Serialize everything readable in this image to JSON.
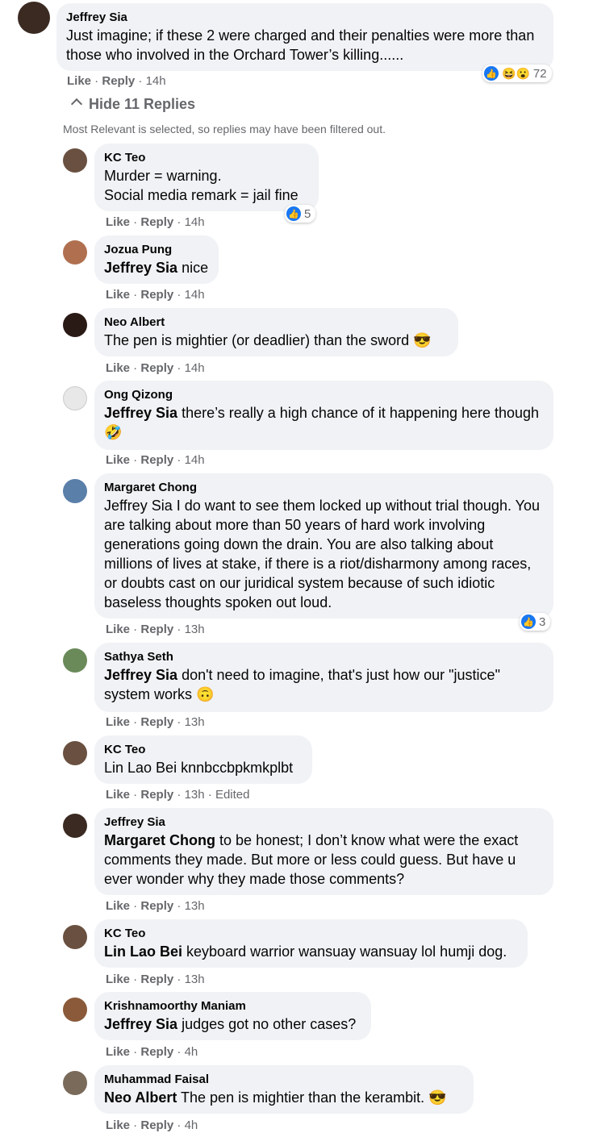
{
  "common": {
    "like": "Like",
    "reply": "Reply",
    "sep": " · "
  },
  "main_comment": {
    "author": "Jeffrey Sia",
    "text": "Just imagine; if these 2 were charged and their penalties were more than those who involved in the Orchard Tower’s killing......",
    "time": "14h",
    "reaction_count": "72",
    "reactions": [
      "like-icon",
      "haha-icon",
      "wow-icon"
    ]
  },
  "hide_replies_label": "Hide 11 Replies",
  "filter_note": "Most Relevant is selected, so replies may have been filtered out.",
  "replies": [
    {
      "author": "KC Teo",
      "mention": "",
      "text": "Murder = warning.\nSocial media remark = jail fine",
      "time": "14h",
      "reaction_count": "5"
    },
    {
      "author": "Jozua Pung",
      "mention": "Jeffrey Sia",
      "text": "nice",
      "time": "14h"
    },
    {
      "author": "Neo Albert",
      "mention": "",
      "text": "The pen is mightier (or deadlier) than the sword",
      "time": "14h",
      "emoji": "sunglasses-emoji"
    },
    {
      "author": "Ong Qizong",
      "mention": "Jeffrey Sia",
      "text": "there’s really a high chance of it happening here though",
      "time": "14h",
      "emoji": "laughing-emoji"
    },
    {
      "author": "Margaret Chong",
      "mention": "",
      "text": "Jeffrey Sia I do want to see them locked up without trial though. You are talking about more than 50 years of hard work involving generations going down the drain. You are also talking about millions of lives at stake, if there is a riot/disharmony among races, or doubts cast on our juridical system because of such idiotic baseless thoughts spoken out loud.",
      "time": "13h",
      "reaction_count": "3"
    },
    {
      "author": "Sathya Seth",
      "mention": "Jeffrey Sia",
      "text": "don't need to imagine, that's just how our \"justice\" system works",
      "time": "13h",
      "emoji": "upside-down-emoji"
    },
    {
      "author": "KC Teo",
      "mention": "",
      "text": "Lin Lao Bei knnbccbpkmkplbt",
      "time": "13h",
      "edited": "Edited"
    },
    {
      "author": "Jeffrey Sia",
      "mention": "Margaret Chong",
      "text": "to be honest; I don’t know what were the exact comments they made. But more or less could guess. But have u ever wonder why they made those comments?",
      "time": "13h"
    },
    {
      "author": "KC Teo",
      "mention": "Lin Lao Bei",
      "text": "keyboard warrior wansuay wansuay lol humji dog.",
      "time": "13h"
    },
    {
      "author": "Krishnamoorthy Maniam",
      "mention": "Jeffrey Sia",
      "text": "judges got no other cases?",
      "time": "4h"
    },
    {
      "author": "Muhammad Faisal",
      "mention": "Neo Albert",
      "text": "The pen is mightier than the kerambit.",
      "time": "4h",
      "emoji": "sunglasses-emoji"
    }
  ]
}
